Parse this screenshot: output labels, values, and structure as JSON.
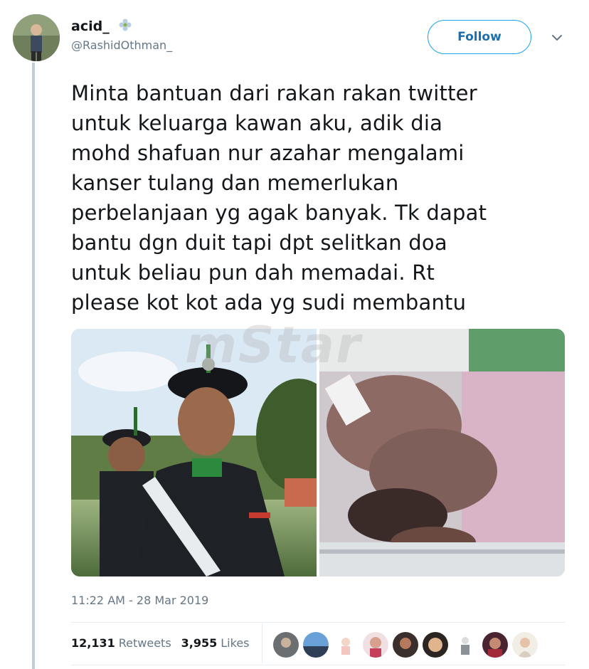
{
  "tweet": {
    "display_name": "acid_",
    "handle": "@RashidOthman_",
    "follow_label": "Follow",
    "text": "Minta bantuan dari rakan rakan twitter\nuntuk keluarga kawan aku, adik dia\nmohd shafuan nur azahar mengalami\nkanser tulang dan memerlukan\nperbelanjaan yg agak banyak. Tk dapat\nbantu dgn duit tapi dpt selitkan doa\nuntuk beliau pun dah memadai. Rt\nplease kot kot ada yg sudi membantu",
    "timestamp": "11:22 AM - 28 Mar 2019",
    "watermark": "mStar"
  },
  "stats": {
    "retweets_count": "12,131",
    "retweets_label": "Retweets",
    "likes_count": "3,955",
    "likes_label": "Likes"
  },
  "colors": {
    "accent": "#1da1f2",
    "secondary_text": "#657786",
    "primary_text": "#14171a"
  }
}
